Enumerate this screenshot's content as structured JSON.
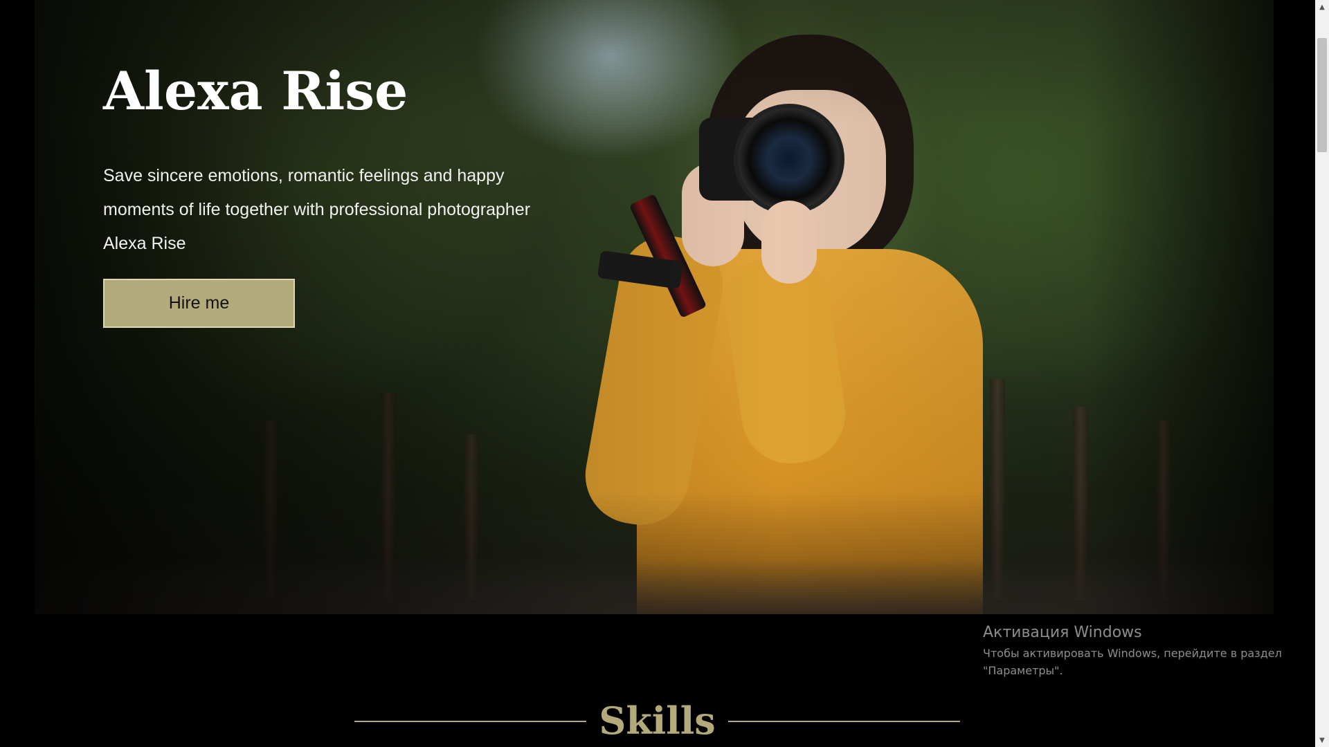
{
  "hero": {
    "title": "Alexa Rise",
    "subtitle": "Save sincere emotions, romantic feelings and happy moments of life together with professional photographer Alexa Rise",
    "cta_label": "Hire me"
  },
  "skills": {
    "title": "Skills"
  },
  "windows_activation": {
    "title": "Активация Windows",
    "text": "Чтобы активировать Windows, перейдите в раздел \"Параметры\"."
  },
  "scrollbar": {
    "up_icon": "chevron-up-icon",
    "down_icon": "chevron-down-icon"
  },
  "colors": {
    "accent": "#b3aa7c",
    "background": "#000000",
    "text": "#ffffff"
  }
}
